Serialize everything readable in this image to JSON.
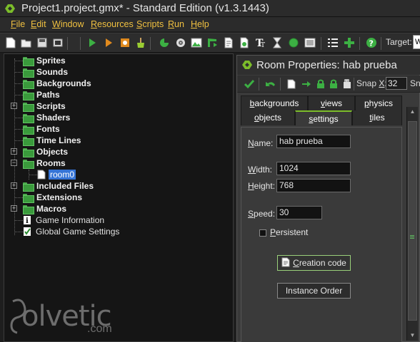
{
  "window": {
    "title": "Project1.project.gmx* - Standard Edition (v1.3.1443)"
  },
  "menu": [
    {
      "label": "File",
      "u": "F",
      "rest": "ile"
    },
    {
      "label": "Edit",
      "u": "E",
      "rest": "dit"
    },
    {
      "label": "Window",
      "u": "W",
      "rest": "indow"
    },
    {
      "label": "Resources",
      "u": "R",
      "rest": "esources"
    },
    {
      "label": "Scripts",
      "u": "S",
      "rest": "cripts"
    },
    {
      "label": "Run",
      "u": "R",
      "rest": "un"
    },
    {
      "label": "Help",
      "u": "H",
      "rest": "elp"
    }
  ],
  "toolbar": {
    "target_label": "Target:",
    "target_value": "W",
    "icons": [
      "new-project-icon",
      "open-project-icon",
      "save-project-icon",
      "create-executable-icon",
      "run-game-icon",
      "debug-game-icon",
      "create-application-icon",
      "clean-icon",
      "add-sprite-icon",
      "add-sound-icon",
      "add-background-icon",
      "add-path-icon",
      "add-script-icon",
      "add-shader-icon",
      "add-font-icon",
      "add-timeline-icon",
      "add-object-icon",
      "add-room-icon",
      "game-information-icon",
      "global-settings-icon",
      "extensions-icon",
      "help-icon"
    ]
  },
  "tree": {
    "items": [
      {
        "label": "Sprites",
        "type": "folder",
        "expandable": false
      },
      {
        "label": "Sounds",
        "type": "folder",
        "expandable": false
      },
      {
        "label": "Backgrounds",
        "type": "folder",
        "expandable": false
      },
      {
        "label": "Paths",
        "type": "folder",
        "expandable": false
      },
      {
        "label": "Scripts",
        "type": "folder",
        "expandable": true
      },
      {
        "label": "Shaders",
        "type": "folder",
        "expandable": false
      },
      {
        "label": "Fonts",
        "type": "folder",
        "expandable": false
      },
      {
        "label": "Time Lines",
        "type": "folder",
        "expandable": false
      },
      {
        "label": "Objects",
        "type": "folder",
        "expandable": true
      },
      {
        "label": "Rooms",
        "type": "folder-open",
        "expandable": true
      },
      {
        "label": "room0",
        "type": "room",
        "expandable": false
      },
      {
        "label": "Included Files",
        "type": "folder",
        "expandable": true
      },
      {
        "label": "Extensions",
        "type": "folder",
        "expandable": false
      },
      {
        "label": "Macros",
        "type": "folder",
        "expandable": true
      },
      {
        "label": "Game Information",
        "type": "info",
        "expandable": false
      },
      {
        "label": "Global Game Settings",
        "type": "settings",
        "expandable": false
      }
    ]
  },
  "watermark": {
    "text": "olvetic",
    "suffix": ".com"
  },
  "room_window": {
    "title": "Room Properties: hab prueba",
    "snap_x_label": "Snap X:",
    "snap_x_u": "X",
    "snap_x_value": "32",
    "snap_y_label": "Sn",
    "tabs_row1": [
      {
        "label": "backgrounds",
        "u": "b",
        "rest": "ackgrounds"
      },
      {
        "label": "views",
        "u": "v",
        "rest": "iews"
      },
      {
        "label": "physics",
        "u": "p",
        "rest": "hysics"
      }
    ],
    "tabs_row2": [
      {
        "label": "objects",
        "u": "o",
        "rest": "bjects"
      },
      {
        "label": "settings",
        "u": "s",
        "rest": "ettings"
      },
      {
        "label": "tiles",
        "u": "t",
        "rest": "iles"
      }
    ],
    "settings": {
      "name_label_u": "N",
      "name_label_rest": "ame:",
      "name_value": "hab prueba",
      "width_label_u": "W",
      "width_label_rest": "idth:",
      "width_value": "1024",
      "height_label_u": "H",
      "height_label_rest": "eight:",
      "height_value": "768",
      "speed_label_u": "S",
      "speed_label_rest": "peed:",
      "speed_value": "30",
      "persistent_label_u": "P",
      "persistent_label_rest": "ersistent",
      "persistent_checked": false,
      "creation_code_u": "C",
      "creation_code_rest": "reation code",
      "instance_order_label": "Instance Order"
    }
  }
}
